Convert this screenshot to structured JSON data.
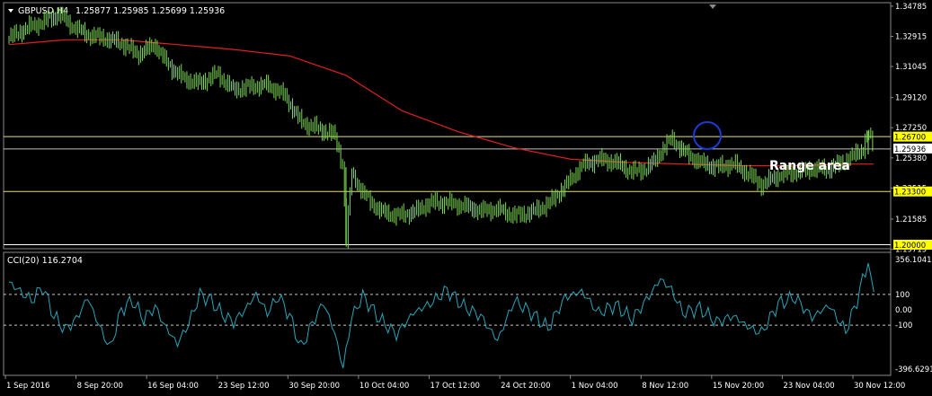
{
  "header": {
    "symbol": "GBPUSD,H4",
    "ohlc": "1.25877 1.25985 1.25699 1.25936",
    "cci_title": "CCI(20) 116.2704"
  },
  "annotation": {
    "range_label": "Range area"
  },
  "colors": {
    "background": "#000000",
    "candles": "#7ed957",
    "moving_average": "#e02020",
    "horizontal_lines": "#e8e070",
    "price_line": "#c0c0c0",
    "cci_line": "#2aa5b8",
    "circle": "#1b3ad6",
    "label_bg": "#ffff00",
    "frame": "#8a8a8a",
    "text": "#ffffff"
  },
  "chart_data": [
    {
      "type": "line",
      "name_printed": "GBPUSD,H4",
      "ylim": [
        1.1975,
        1.35
      ],
      "y_ticks": [
        "1.34785",
        "1.32915",
        "1.31045",
        "1.29120",
        "1.27250",
        "1.25380",
        "1.23515",
        "1.21585",
        "1.19715"
      ],
      "x_ticks": [
        "1 Sep 2016",
        "8 Sep 20:00",
        "16 Sep 04:00",
        "23 Sep 12:00",
        "30 Sep 20:00",
        "10 Oct 04:00",
        "17 Oct 12:00",
        "24 Oct 20:00",
        "1 Nov 04:00",
        "8 Nov 12:00",
        "15 Nov 20:00",
        "23 Nov 04:00",
        "30 Nov 12:00"
      ],
      "horizontal_levels": [
        {
          "label": "1.26700",
          "value": 1.267
        },
        {
          "label": "1.23300",
          "value": 1.233
        },
        {
          "label": "1.20000",
          "value": 1.2
        }
      ],
      "current_price": {
        "label": "1.25936",
        "value": 1.25936
      },
      "price_path": [
        [
          0,
          1.328
        ],
        [
          3,
          1.334
        ],
        [
          6,
          1.338
        ],
        [
          9,
          1.343
        ],
        [
          11,
          1.336
        ],
        [
          14,
          1.33
        ],
        [
          17,
          1.328
        ],
        [
          20,
          1.325
        ],
        [
          23,
          1.318
        ],
        [
          26,
          1.324
        ],
        [
          28,
          1.313
        ],
        [
          31,
          1.303
        ],
        [
          34,
          1.3
        ],
        [
          37,
          1.306
        ],
        [
          40,
          1.296
        ],
        [
          43,
          1.298
        ],
        [
          46,
          1.299
        ],
        [
          49,
          1.293
        ],
        [
          52,
          1.276
        ],
        [
          55,
          1.272
        ],
        [
          58,
          1.268
        ],
        [
          59.5,
          1.248
        ],
        [
          60,
          1.2
        ],
        [
          61,
          1.245
        ],
        [
          63,
          1.232
        ],
        [
          66,
          1.221
        ],
        [
          69,
          1.218
        ],
        [
          72,
          1.22
        ],
        [
          75,
          1.226
        ],
        [
          78,
          1.226
        ],
        [
          81,
          1.224
        ],
        [
          84,
          1.221
        ],
        [
          87,
          1.222
        ],
        [
          90,
          1.218
        ],
        [
          93,
          1.22
        ],
        [
          96,
          1.225
        ],
        [
          99,
          1.236
        ],
        [
          102,
          1.249
        ],
        [
          105,
          1.253
        ],
        [
          108,
          1.251
        ],
        [
          111,
          1.245
        ],
        [
          114,
          1.248
        ],
        [
          116,
          1.257
        ],
        [
          118,
          1.266
        ],
        [
          120,
          1.258
        ],
        [
          123,
          1.251
        ],
        [
          126,
          1.248
        ],
        [
          129,
          1.25
        ],
        [
          132,
          1.243
        ],
        [
          134,
          1.237
        ],
        [
          137,
          1.243
        ],
        [
          140,
          1.245
        ],
        [
          143,
          1.247
        ],
        [
          146,
          1.247
        ],
        [
          149,
          1.252
        ],
        [
          152,
          1.259
        ],
        [
          153,
          1.27
        ],
        [
          154,
          1.2594
        ]
      ],
      "moving_average": [
        [
          0,
          1.324
        ],
        [
          10,
          1.327
        ],
        [
          20,
          1.327
        ],
        [
          30,
          1.324
        ],
        [
          40,
          1.321
        ],
        [
          50,
          1.317
        ],
        [
          60,
          1.305
        ],
        [
          70,
          1.283
        ],
        [
          80,
          1.27
        ],
        [
          90,
          1.26
        ],
        [
          100,
          1.253
        ],
        [
          110,
          1.251
        ],
        [
          120,
          1.25
        ],
        [
          130,
          1.249
        ],
        [
          140,
          1.249
        ],
        [
          150,
          1.25
        ],
        [
          154,
          1.25
        ]
      ]
    },
    {
      "type": "line",
      "name_printed": "CCI(20) 116.2704",
      "ylim": [
        -396.6291,
        356.1041
      ],
      "y_ticks": [
        {
          "label": "356.1041",
          "value": 356.1041
        },
        {
          "label": "100",
          "value": 100
        },
        {
          "label": "0.00",
          "value": 0
        },
        {
          "label": "-100",
          "value": -100
        },
        {
          "label": "-396.6291",
          "value": -396.6291
        }
      ],
      "reference_levels": [
        100,
        -100
      ],
      "values": [
        [
          0,
          180
        ],
        [
          2,
          120
        ],
        [
          4,
          60
        ],
        [
          6,
          150
        ],
        [
          8,
          -40
        ],
        [
          10,
          -130
        ],
        [
          12,
          -60
        ],
        [
          14,
          80
        ],
        [
          16,
          -100
        ],
        [
          18,
          -250
        ],
        [
          20,
          0
        ],
        [
          22,
          60
        ],
        [
          24,
          -60
        ],
        [
          26,
          20
        ],
        [
          28,
          -120
        ],
        [
          30,
          -220
        ],
        [
          32,
          -90
        ],
        [
          34,
          100
        ],
        [
          36,
          60
        ],
        [
          38,
          -30
        ],
        [
          40,
          -80
        ],
        [
          42,
          0
        ],
        [
          44,
          100
        ],
        [
          46,
          -20
        ],
        [
          48,
          90
        ],
        [
          50,
          -40
        ],
        [
          52,
          -250
        ],
        [
          54,
          -90
        ],
        [
          56,
          50
        ],
        [
          58,
          -150
        ],
        [
          59.5,
          -380
        ],
        [
          61,
          -50
        ],
        [
          63,
          90
        ],
        [
          66,
          -60
        ],
        [
          69,
          -160
        ],
        [
          72,
          -20
        ],
        [
          75,
          40
        ],
        [
          78,
          130
        ],
        [
          81,
          20
        ],
        [
          84,
          -40
        ],
        [
          87,
          -200
        ],
        [
          90,
          60
        ],
        [
          93,
          -20
        ],
        [
          96,
          -120
        ],
        [
          99,
          80
        ],
        [
          102,
          120
        ],
        [
          105,
          -20
        ],
        [
          108,
          30
        ],
        [
          111,
          -60
        ],
        [
          114,
          90
        ],
        [
          116,
          200
        ],
        [
          118,
          130
        ],
        [
          120,
          -20
        ],
        [
          123,
          10
        ],
        [
          126,
          -80
        ],
        [
          129,
          -40
        ],
        [
          132,
          -120
        ],
        [
          134,
          -150
        ],
        [
          137,
          40
        ],
        [
          140,
          80
        ],
        [
          143,
          -50
        ],
        [
          146,
          30
        ],
        [
          149,
          -140
        ],
        [
          151,
          60
        ],
        [
          153,
          320
        ],
        [
          154,
          116.27
        ]
      ]
    }
  ]
}
